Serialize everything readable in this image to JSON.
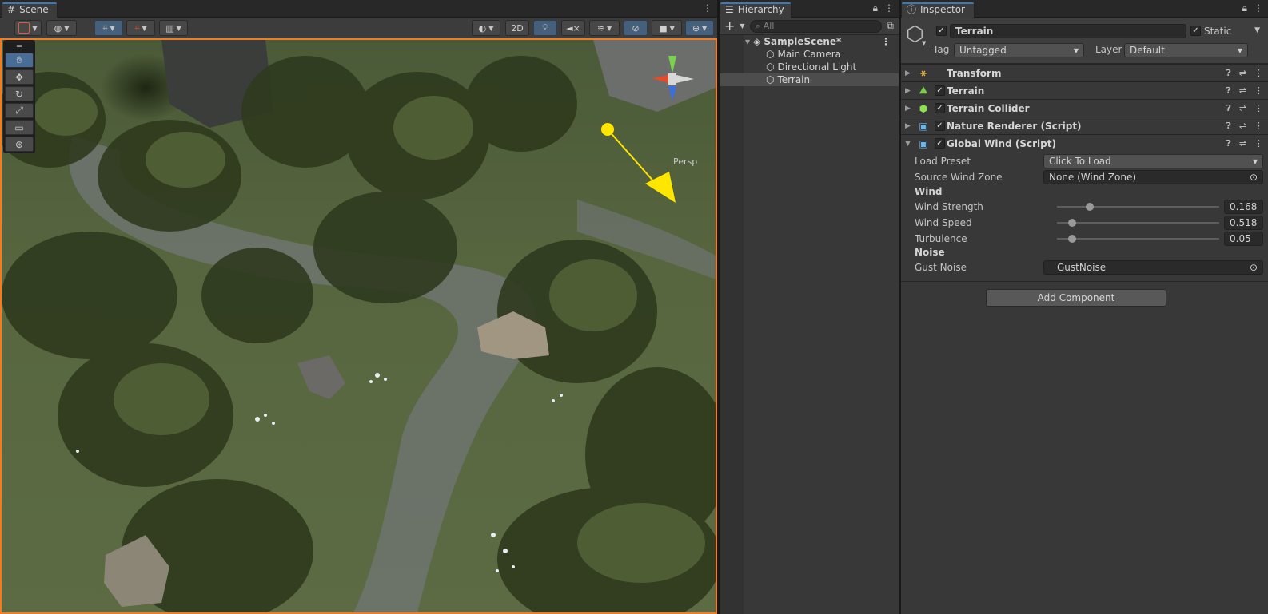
{
  "scene": {
    "tab_label": "Scene",
    "toolbar": {
      "mode_2d": "2D"
    },
    "view_label": "Persp",
    "tools": [
      "hand",
      "move",
      "rotate",
      "scale",
      "rect",
      "transform"
    ]
  },
  "hierarchy": {
    "tab_label": "Hierarchy",
    "search_placeholder": "All",
    "scene_name": "SampleScene*",
    "items": [
      {
        "label": "Main Camera"
      },
      {
        "label": "Directional Light"
      },
      {
        "label": "Terrain",
        "selected": true
      }
    ]
  },
  "inspector": {
    "tab_label": "Inspector",
    "object_name": "Terrain",
    "static_label": "Static",
    "tag_label": "Tag",
    "tag_value": "Untagged",
    "layer_label": "Layer",
    "layer_value": "Default",
    "components": [
      {
        "title": "Transform",
        "has_checkbox": false,
        "icon": "transform-icon"
      },
      {
        "title": "Terrain",
        "has_checkbox": true,
        "icon": "terrain-icon"
      },
      {
        "title": "Terrain Collider",
        "has_checkbox": true,
        "icon": "collider-icon"
      },
      {
        "title": "Nature Renderer (Script)",
        "has_checkbox": true,
        "icon": "script-icon"
      },
      {
        "title": "Global Wind (Script)",
        "has_checkbox": true,
        "icon": "script-icon",
        "expanded": true
      }
    ],
    "global_wind": {
      "load_preset_label": "Load Preset",
      "load_preset_value": "Click To Load",
      "source_wind_zone_label": "Source Wind Zone",
      "source_wind_zone_value": "None (Wind Zone)",
      "wind_header": "Wind",
      "wind_strength_label": "Wind Strength",
      "wind_strength_value": "0.168",
      "wind_strength_fraction": 0.168,
      "wind_speed_label": "Wind Speed",
      "wind_speed_value": "0.518",
      "wind_speed_fraction": 0.052,
      "turbulence_label": "Turbulence",
      "turbulence_value": "0.05",
      "turbulence_fraction": 0.05,
      "noise_header": "Noise",
      "gust_noise_label": "Gust Noise",
      "gust_noise_value": "GustNoise"
    },
    "add_component_label": "Add Component"
  },
  "colors": {
    "accent": "#3a79bb",
    "scene_border": "#f47b20",
    "selected_row": "#4d4d4d"
  }
}
